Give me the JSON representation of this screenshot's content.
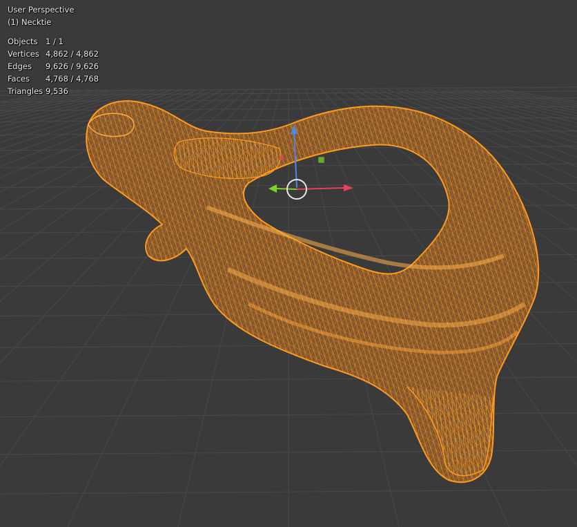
{
  "viewport": {
    "view_name": "User Perspective",
    "object_label": "(1) Necktie"
  },
  "statistics": [
    {
      "label": "Objects",
      "value": "1 / 1"
    },
    {
      "label": "Vertices",
      "value": "4,862 / 4,862"
    },
    {
      "label": "Edges",
      "value": "9,626 / 9,626"
    },
    {
      "label": "Faces",
      "value": "4,768 / 4,768"
    },
    {
      "label": "Triangles",
      "value": "9,536"
    }
  ],
  "colors": {
    "background": "#3a3a3a",
    "grid": "#4a4a4a",
    "mesh_wire": "#ff9a1f",
    "mesh_fill": "#c8731e",
    "axis_x": "#e0455c",
    "axis_y": "#7fcf2f",
    "axis_z": "#4f86e8"
  },
  "icons": {
    "transform_gizmo": "move-gizmo-icon"
  }
}
